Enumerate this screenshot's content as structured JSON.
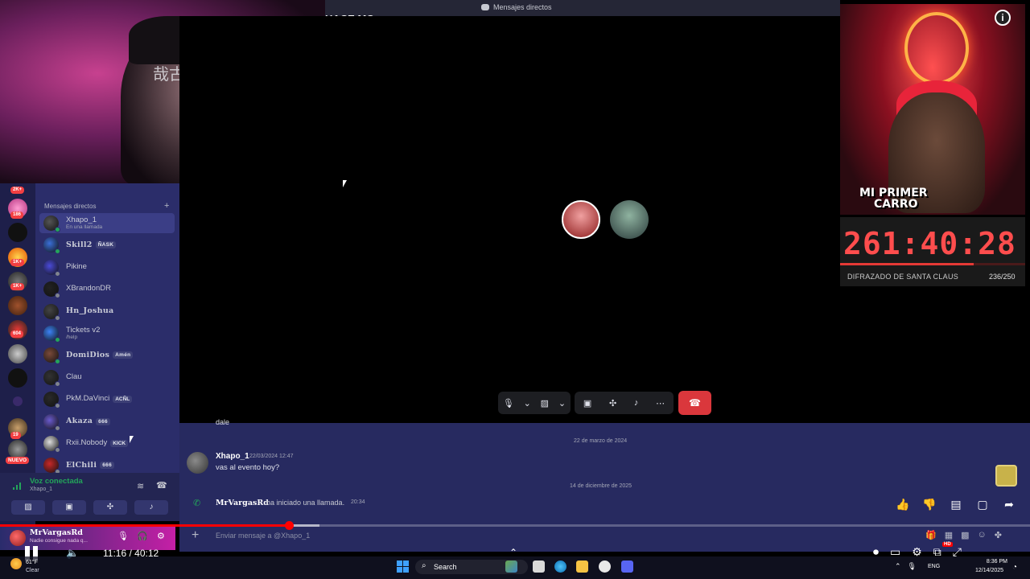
{
  "discord": {
    "window_title": "Mensajes directos",
    "overlay_username": "HACE MG",
    "dm_section_header": "Mensajes directos",
    "dm_list": [
      {
        "name": "Xhapo_1",
        "sub": "En una llamada",
        "tag": "",
        "status": "online",
        "active": true,
        "styled": false
      },
      {
        "name": "Skill2",
        "sub": "",
        "tag": "ÑASK",
        "status": "online",
        "active": false,
        "styled": true
      },
      {
        "name": "Pikine",
        "sub": "",
        "tag": "",
        "status": "offline",
        "active": false,
        "styled": false
      },
      {
        "name": "XBrandonDR",
        "sub": "",
        "tag": "",
        "status": "offline",
        "active": false,
        "styled": false
      },
      {
        "name": "Hn_Joshua",
        "sub": "",
        "tag": "",
        "status": "offline",
        "active": false,
        "styled": true
      },
      {
        "name": "Tickets v2",
        "sub": "/help",
        "tag": "",
        "status": "online",
        "active": false,
        "styled": false
      },
      {
        "name": "DomiDios",
        "sub": "",
        "tag": "Amén",
        "status": "online",
        "active": false,
        "styled": true
      },
      {
        "name": "Clau",
        "sub": "",
        "tag": "",
        "status": "offline",
        "active": false,
        "styled": false
      },
      {
        "name": "PkM.DaVinci",
        "sub": "",
        "tag": "ACÑL",
        "status": "offline",
        "active": false,
        "styled": false
      },
      {
        "name": "Akaza",
        "sub": "",
        "tag": "666",
        "status": "offline",
        "active": false,
        "styled": true
      },
      {
        "name": "Rxii.Nobody",
        "sub": "",
        "tag": "KICK",
        "status": "offline",
        "active": false,
        "styled": false
      },
      {
        "name": "ElChili",
        "sub": "",
        "tag": "666",
        "status": "offline",
        "active": false,
        "styled": true
      }
    ],
    "server_badges": [
      "2K+",
      "186",
      "1K+",
      "1K+",
      "604",
      "19"
    ],
    "new_badge": "NUEVO",
    "voice": {
      "title": "Voz conectada",
      "channel": "Xhapo_1"
    },
    "user": {
      "name": "MrVargasRd",
      "status": "Nadie consigue nada q..."
    },
    "chat": {
      "prev_message": "dale",
      "date_divider_1": "22 de marzo de 2024",
      "message": {
        "author": "Xhapo_1",
        "timestamp": "22/03/2024 12:47",
        "text": "vas al evento hoy?"
      },
      "date_divider_2": "14 de diciembre de 2025",
      "call_event": {
        "user": "MrVargasRd",
        "text": "ha iniciado una llamada.",
        "time": "20:34"
      },
      "input_placeholder": "Enviar mensaje a @Xhapo_1"
    }
  },
  "stream_overlay": {
    "promo_line1": "MI PRIMER",
    "promo_line2": "CARRO",
    "timer": "261:40:28",
    "goal_label": "DIFRAZADO DE SANTA CLAUS",
    "goal_count": "236/250",
    "goal_progress": 0.72
  },
  "video_player": {
    "current_time": "11:16",
    "duration": "40:12",
    "progress": 0.2803,
    "buffered": 0.31,
    "quality_badge": "HD"
  },
  "taskbar": {
    "weather_temp": "61°F",
    "weather_cond": "Clear",
    "search_label": "Search",
    "language": "ENG",
    "time": "8:36 PM",
    "date": "12/14/2025"
  },
  "colors": {
    "discord_panel": "#2b2d6a",
    "online": "#23a55a",
    "hangup": "#da373c",
    "timer": "#ff4d4d"
  }
}
